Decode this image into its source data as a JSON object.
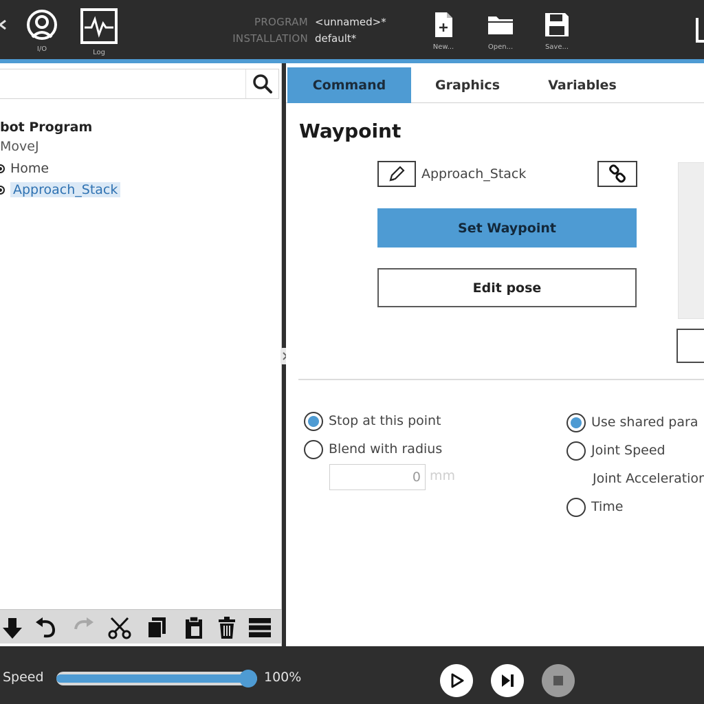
{
  "header": {
    "io_label": "I/O",
    "log_label": "Log",
    "program_key": "PROGRAM",
    "program_value": "<unnamed>*",
    "installation_key": "INSTALLATION",
    "installation_value": "default*",
    "new_label": "New...",
    "open_label": "Open...",
    "save_label": "Save..."
  },
  "tree": {
    "root": "bot Program",
    "movej": "MoveJ",
    "home": "Home",
    "approach": "Approach_Stack"
  },
  "tabs": [
    "Command",
    "Graphics",
    "Variables"
  ],
  "waypoint": {
    "title": "Waypoint",
    "name": "Approach_Stack",
    "set_label": "Set Waypoint",
    "edit_label": "Edit pose"
  },
  "options": {
    "stop": "Stop at this point",
    "blend": "Blend with radius",
    "radius_value": "0",
    "radius_unit": "mm",
    "shared": "Use shared para",
    "joint_speed": "Joint Speed",
    "joint_accel": "Joint Acceleration",
    "time": "Time"
  },
  "footer": {
    "speed_label": "Speed",
    "speed_value": "100%",
    "speed_fraction": 1.0
  },
  "colors": {
    "accent": "#4e9bd3",
    "dark": "#2c2c2c"
  },
  "icons": [
    "io-icon",
    "log-icon",
    "new-file-icon",
    "open-folder-icon",
    "save-icon",
    "search-icon",
    "pencil-icon",
    "link-icon",
    "move-down-icon",
    "undo-icon",
    "redo-icon",
    "cut-icon",
    "copy-icon",
    "paste-icon",
    "delete-icon",
    "suppress-icon",
    "play-icon",
    "step-icon",
    "stop-icon"
  ]
}
